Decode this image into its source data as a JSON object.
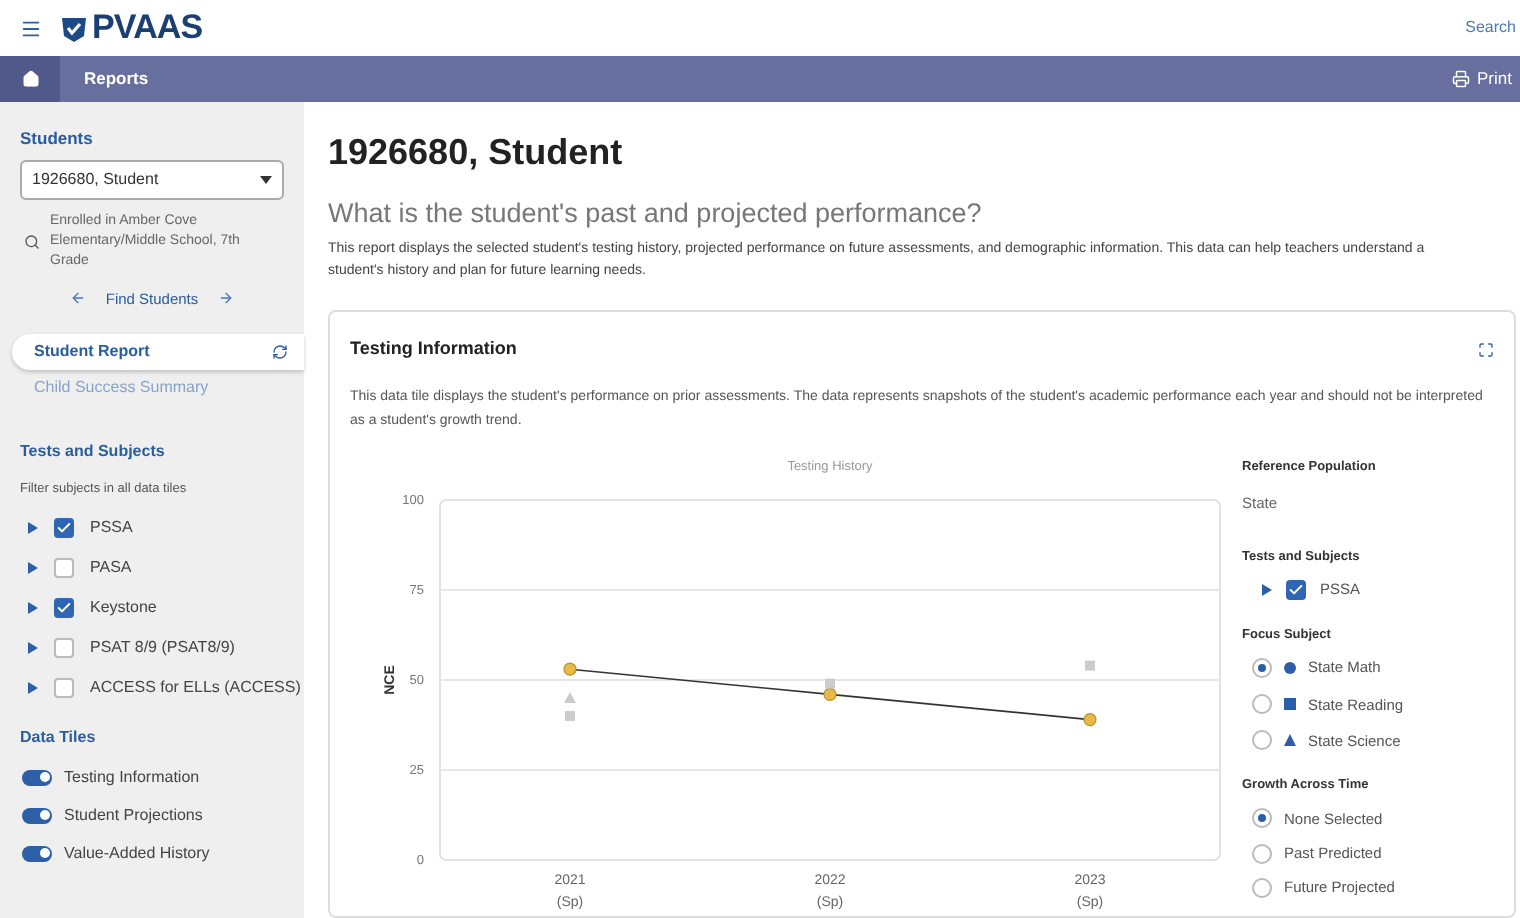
{
  "header": {
    "brand": "PVAAS",
    "search": "Search"
  },
  "nav": {
    "title": "Reports",
    "print": "Print"
  },
  "sidebar": {
    "students_label": "Students",
    "student_select": "1926680, Student",
    "enrollment": "Enrolled in Amber Cove Elementary/Middle School, 7th Grade",
    "find_students": "Find Students",
    "reports": [
      {
        "label": "Student Report",
        "selected": true
      },
      {
        "label": "Child Success Summary",
        "selected": false
      }
    ],
    "tests_heading": "Tests and Subjects",
    "tests_hint": "Filter subjects in all data tiles",
    "tests": [
      {
        "label": "PSSA",
        "checked": true
      },
      {
        "label": "PASA",
        "checked": false
      },
      {
        "label": "Keystone",
        "checked": true
      },
      {
        "label": "PSAT 8/9 (PSAT8/9)",
        "checked": false
      },
      {
        "label": "ACCESS for ELLs (ACCESS)",
        "checked": false
      }
    ],
    "tiles_heading": "Data Tiles",
    "tiles": [
      {
        "label": "Testing Information",
        "on": true
      },
      {
        "label": "Student Projections",
        "on": true
      },
      {
        "label": "Value-Added History",
        "on": true
      }
    ]
  },
  "main": {
    "title": "1926680, Student",
    "question": "What is the student's past and projected performance?",
    "description": "This report displays the selected student's testing history, projected performance on future assessments, and demographic information. This data can help teachers understand a student's history and plan for future learning needs.",
    "card": {
      "title": "Testing Information",
      "description": "This data tile displays the student's performance on prior assessments. The data represents snapshots of the student's academic performance each year and should not be interpreted as a student's growth trend.",
      "chart_data": {
        "type": "line",
        "title": "Testing History",
        "ylabel": "NCE",
        "categories": [
          "2021 (Sp)",
          "2022 (Sp)",
          "2023 (Sp)"
        ],
        "ylim": [
          0,
          100
        ],
        "yticks": [
          0,
          25,
          50,
          75,
          100
        ],
        "grid": true,
        "series": [
          {
            "name": "State Math",
            "type": "line",
            "marker": "circle",
            "color": "#e8b949",
            "values": [
              53,
              46,
              39
            ]
          },
          {
            "name": "State Reading",
            "type": "scatter",
            "marker": "square",
            "color": "#cccccc",
            "values": [
              40,
              49,
              54
            ]
          },
          {
            "name": "State Science",
            "type": "scatter",
            "marker": "triangle",
            "color": "#cccccc",
            "values": [
              45,
              null,
              null
            ]
          }
        ]
      },
      "options": {
        "reference_heading": "Reference Population",
        "reference_value": "State",
        "tests_heading": "Tests and Subjects",
        "tests": [
          {
            "label": "PSSA",
            "checked": true
          }
        ],
        "focus_heading": "Focus Subject",
        "focus": [
          {
            "kind": "circle",
            "selected": true
          },
          {
            "kind": "square",
            "selected": false
          },
          {
            "kind": "triangle",
            "selected": false
          }
        ],
        "growth_heading": "Growth Across Time",
        "growth": [
          {
            "label": "None Selected",
            "selected": true
          },
          {
            "label": "Past Predicted",
            "selected": false
          },
          {
            "label": "Future Projected",
            "selected": false
          }
        ]
      }
    }
  }
}
